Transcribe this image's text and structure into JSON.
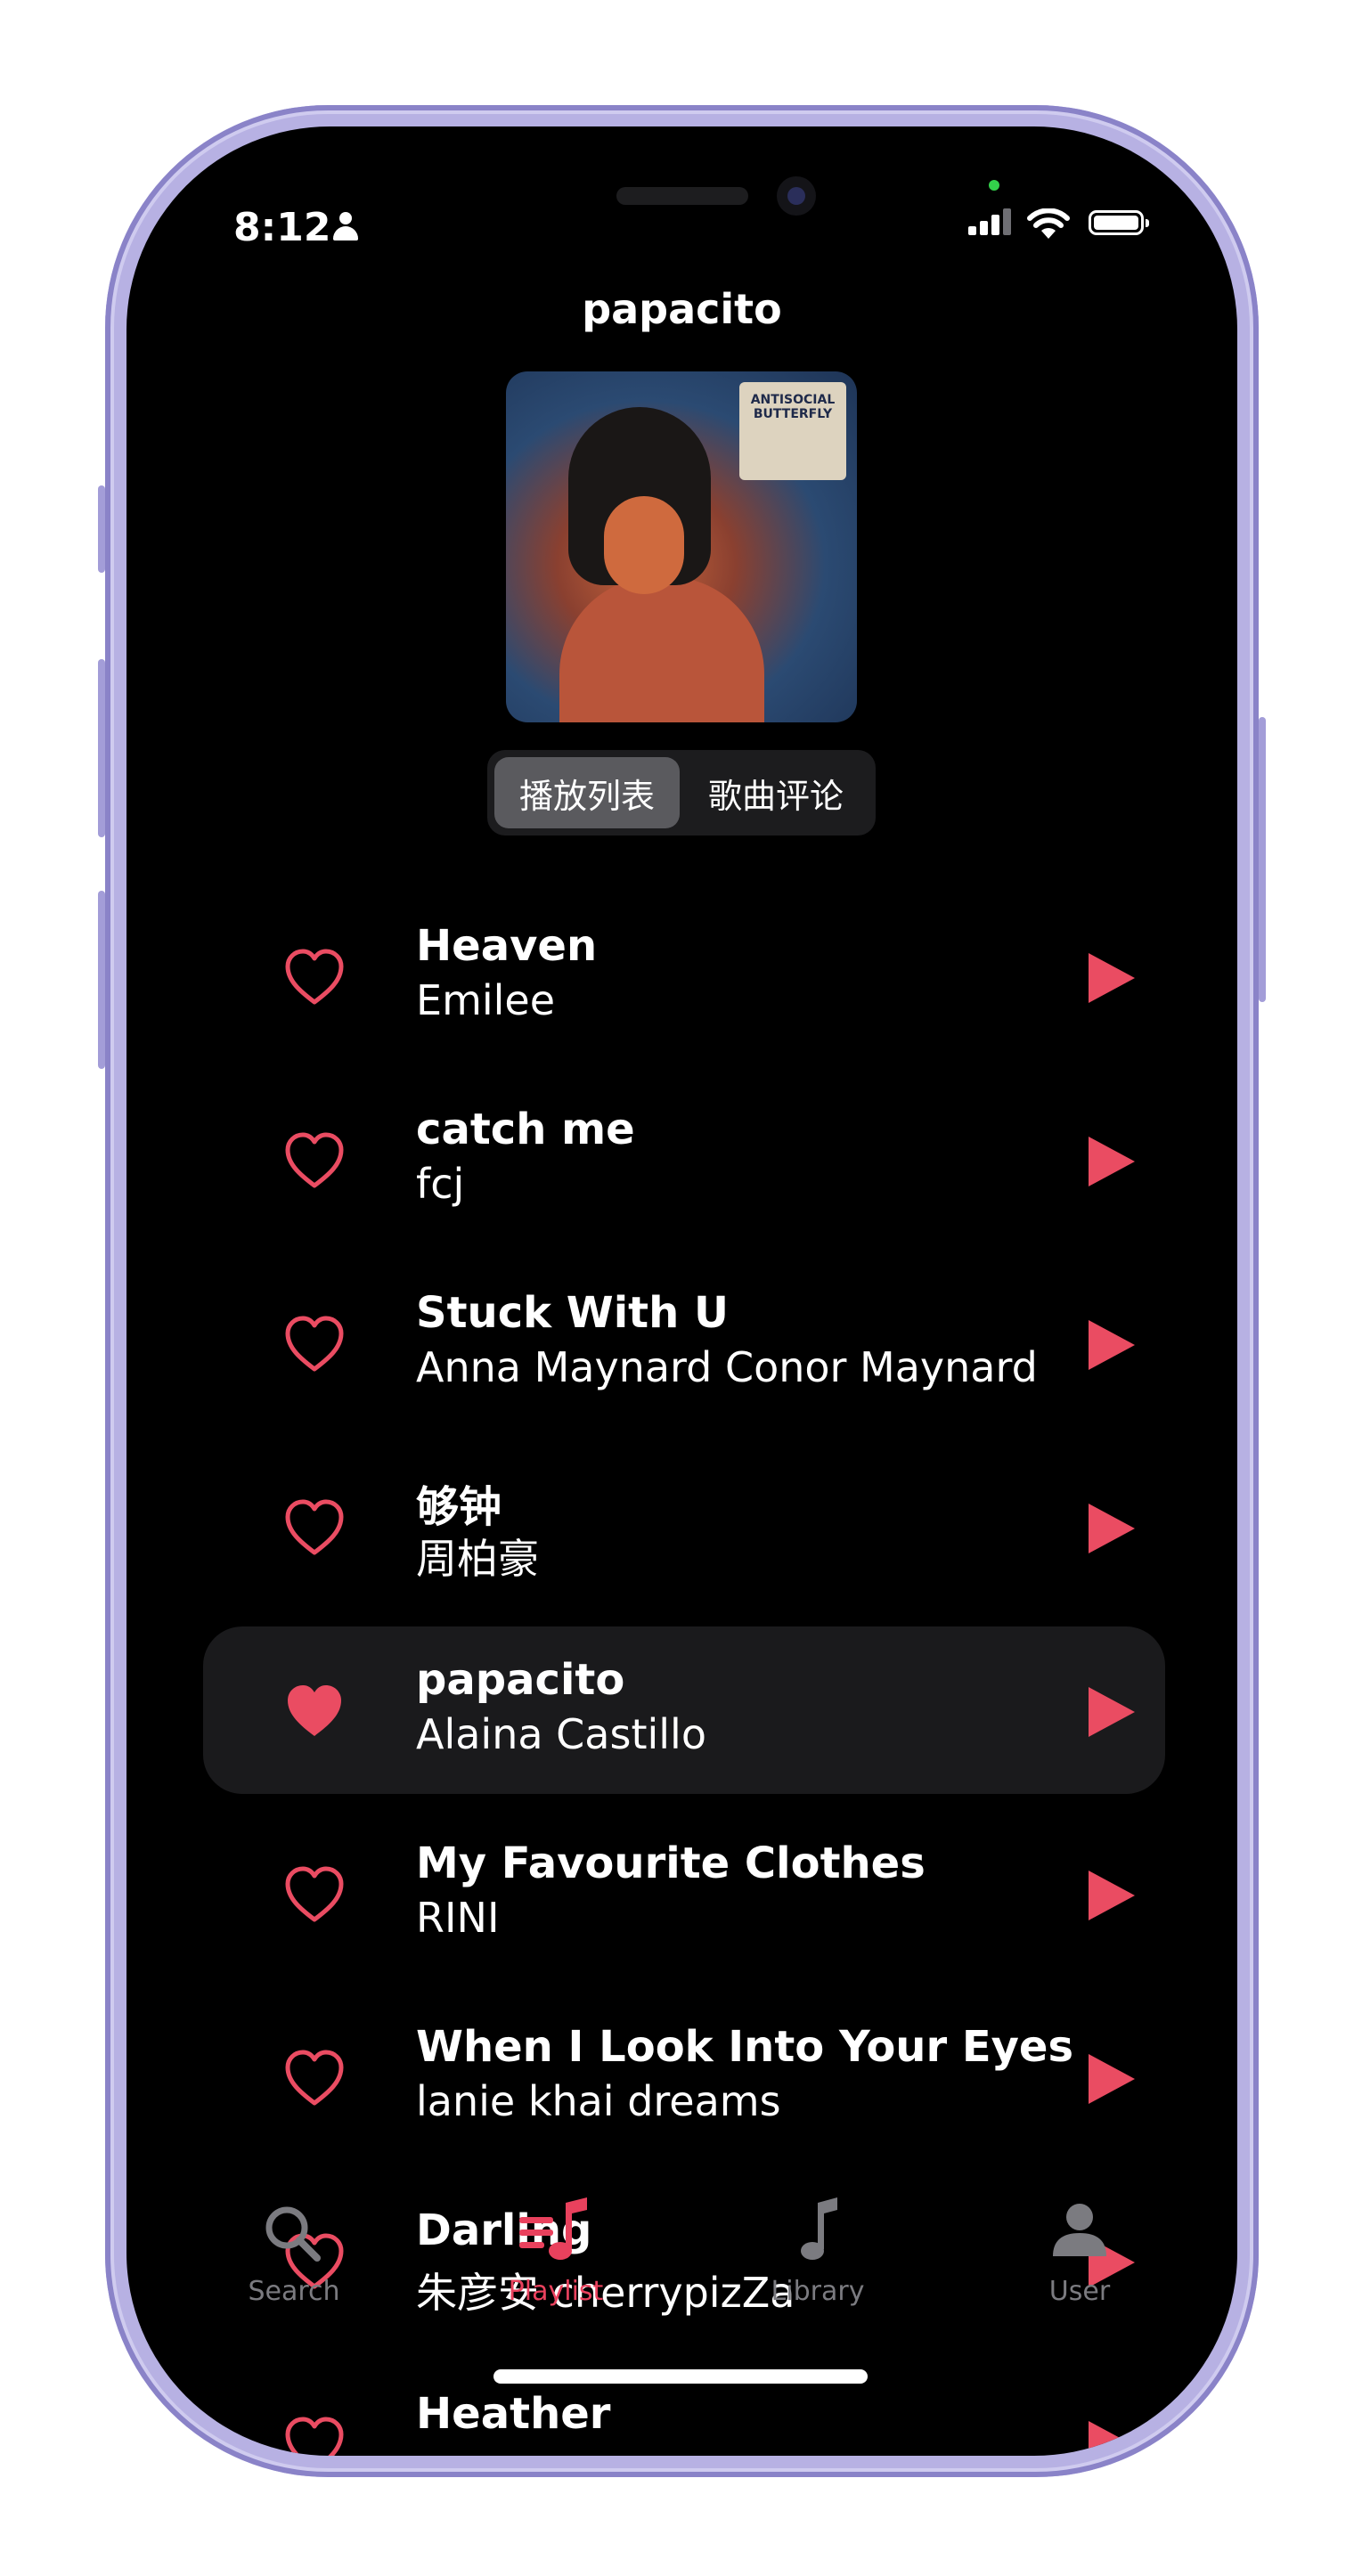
{
  "status_bar": {
    "time": "8:12"
  },
  "header": {
    "title": "papacito"
  },
  "album": {
    "sticker_text": "ANTISOCIAL BUTTERFLY"
  },
  "segment": {
    "tabs": [
      "播放列表",
      "歌曲评论"
    ],
    "selected": "播放列表"
  },
  "songs": [
    {
      "title": "Heaven",
      "artist": "Emilee",
      "liked": false,
      "playing": false
    },
    {
      "title": "catch me",
      "artist": "fcj",
      "liked": false,
      "playing": false
    },
    {
      "title": "Stuck With U",
      "artist": "Anna Maynard  Conor Maynard",
      "liked": false,
      "playing": false
    },
    {
      "title": "够钟",
      "artist": "周柏豪",
      "liked": false,
      "playing": false
    },
    {
      "title": "papacito",
      "artist": "Alaina Castillo",
      "liked": true,
      "playing": true
    },
    {
      "title": "My Favourite Clothes",
      "artist": "RINI",
      "liked": false,
      "playing": false
    },
    {
      "title": "When I Look Into Your Eyes",
      "artist": "lanie  khai dreams",
      "liked": false,
      "playing": false
    },
    {
      "title": "Darling",
      "artist": "朱彦安  cherrypizZa",
      "liked": false,
      "playing": false
    },
    {
      "title": "Heather",
      "artist": "",
      "liked": false,
      "playing": false
    }
  ],
  "tabbar": {
    "items": [
      {
        "label": "Search",
        "icon": "search-icon",
        "active": false
      },
      {
        "label": "Playlist",
        "icon": "playlist-icon",
        "active": true
      },
      {
        "label": "Library",
        "icon": "music-note-icon",
        "active": false
      },
      {
        "label": "User",
        "icon": "user-icon",
        "active": false
      }
    ]
  },
  "colors": {
    "accent": "#ea4c62",
    "background": "#000000",
    "frame": "#b7b1e3"
  }
}
